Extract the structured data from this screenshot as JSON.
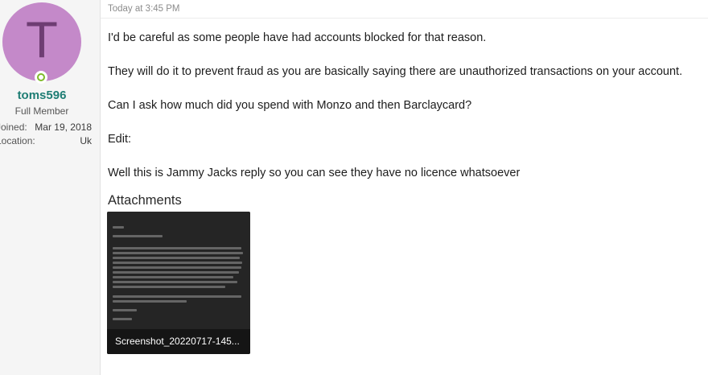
{
  "user": {
    "avatar_letter": "T",
    "username": "toms596",
    "title": "Full Member",
    "joined_label": "Joined:",
    "joined_value": "Mar 19, 2018",
    "location_label": "Location:",
    "location_value": "Uk",
    "online_color": "#7fba2a",
    "avatar_color": "#c489c9"
  },
  "post": {
    "timestamp": "Today at 3:45 PM",
    "paragraphs": [
      "I'd be careful as some people have had accounts blocked for that reason.",
      "They will do it to prevent fraud as you are basically saying there are unauthorized transactions on your account.",
      "Can I ask how much did you spend with Monzo and then Barclaycard?",
      "Edit:",
      "Well this is Jammy Jacks reply so you can see they have no licence whatsoever"
    ]
  },
  "attachments": {
    "heading": "Attachments",
    "items": [
      {
        "filename": "Screenshot_20220717-145..."
      }
    ]
  }
}
